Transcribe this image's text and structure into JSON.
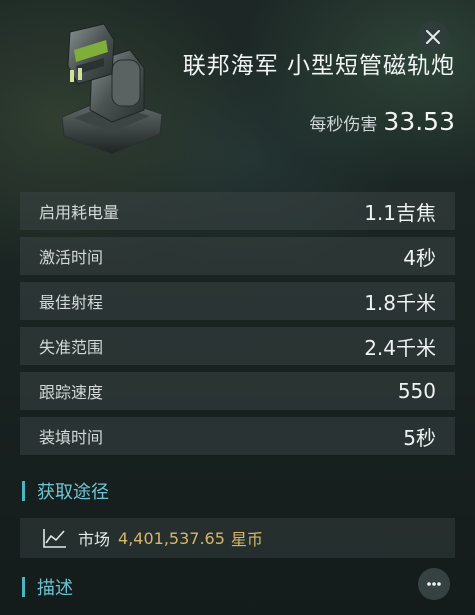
{
  "item": {
    "name": "联邦海军 小型短管磁轨炮",
    "dps_label": "每秒伤害",
    "dps_value": "33.53"
  },
  "stats": [
    {
      "label": "启用耗电量",
      "value": "1.1吉焦"
    },
    {
      "label": "激活时间",
      "value": "4秒"
    },
    {
      "label": "最佳射程",
      "value": "1.8千米"
    },
    {
      "label": "失准范围",
      "value": "2.4千米"
    },
    {
      "label": "跟踪速度",
      "value": "550"
    },
    {
      "label": "装填时间",
      "value": "5秒"
    }
  ],
  "sources": {
    "title": "获取途径",
    "market": {
      "icon": "chart-line-icon",
      "label": "市场",
      "price": "4,401,537.65",
      "unit": "星币"
    }
  },
  "description": {
    "title": "描述"
  },
  "colors": {
    "accent": "#4fb3c6",
    "price": "#d6b66c"
  }
}
